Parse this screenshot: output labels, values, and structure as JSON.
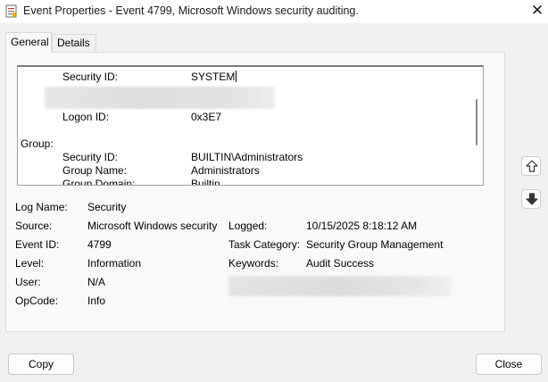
{
  "window": {
    "title": "Event Properties - Event 4799, Microsoft Windows security auditing.",
    "close_glyph": "✕"
  },
  "tabs": [
    {
      "label": "General",
      "active": true
    },
    {
      "label": "Details",
      "active": false
    }
  ],
  "description": {
    "subject_security_id_label": "Security ID:",
    "subject_security_id_value": "SYSTEM",
    "logon_id_label": "Logon ID:",
    "logon_id_value": "0x3E7",
    "group_heading": "Group:",
    "group_security_id_label": "Security ID:",
    "group_security_id_value": "BUILTIN\\Administrators",
    "group_name_label": "Group Name:",
    "group_name_value": "Administrators",
    "group_domain_label": "Group Domain:",
    "group_domain_value": "Builtin"
  },
  "fields": {
    "log_name": {
      "label": "Log Name:",
      "value": "Security"
    },
    "source": {
      "label": "Source:",
      "value": "Microsoft Windows security"
    },
    "logged": {
      "label": "Logged:",
      "value": "10/15/2025 8:18:12 AM"
    },
    "event_id": {
      "label": "Event ID:",
      "value": "4799"
    },
    "task_category": {
      "label": "Task Category:",
      "value": "Security Group Management"
    },
    "level": {
      "label": "Level:",
      "value": "Information"
    },
    "keywords": {
      "label": "Keywords:",
      "value": "Audit Success"
    },
    "user": {
      "label": "User:",
      "value": "N/A"
    },
    "opcode": {
      "label": "OpCode:",
      "value": "Info"
    }
  },
  "buttons": {
    "copy": "Copy",
    "close": "Close"
  },
  "icons": {
    "app": "event-viewer-icon",
    "up": "arrow-up-icon",
    "down": "arrow-down-icon"
  },
  "colors": {
    "window_bg": "#f0f0f0",
    "panel_bg": "#f9f9f9",
    "text": "#000000"
  }
}
